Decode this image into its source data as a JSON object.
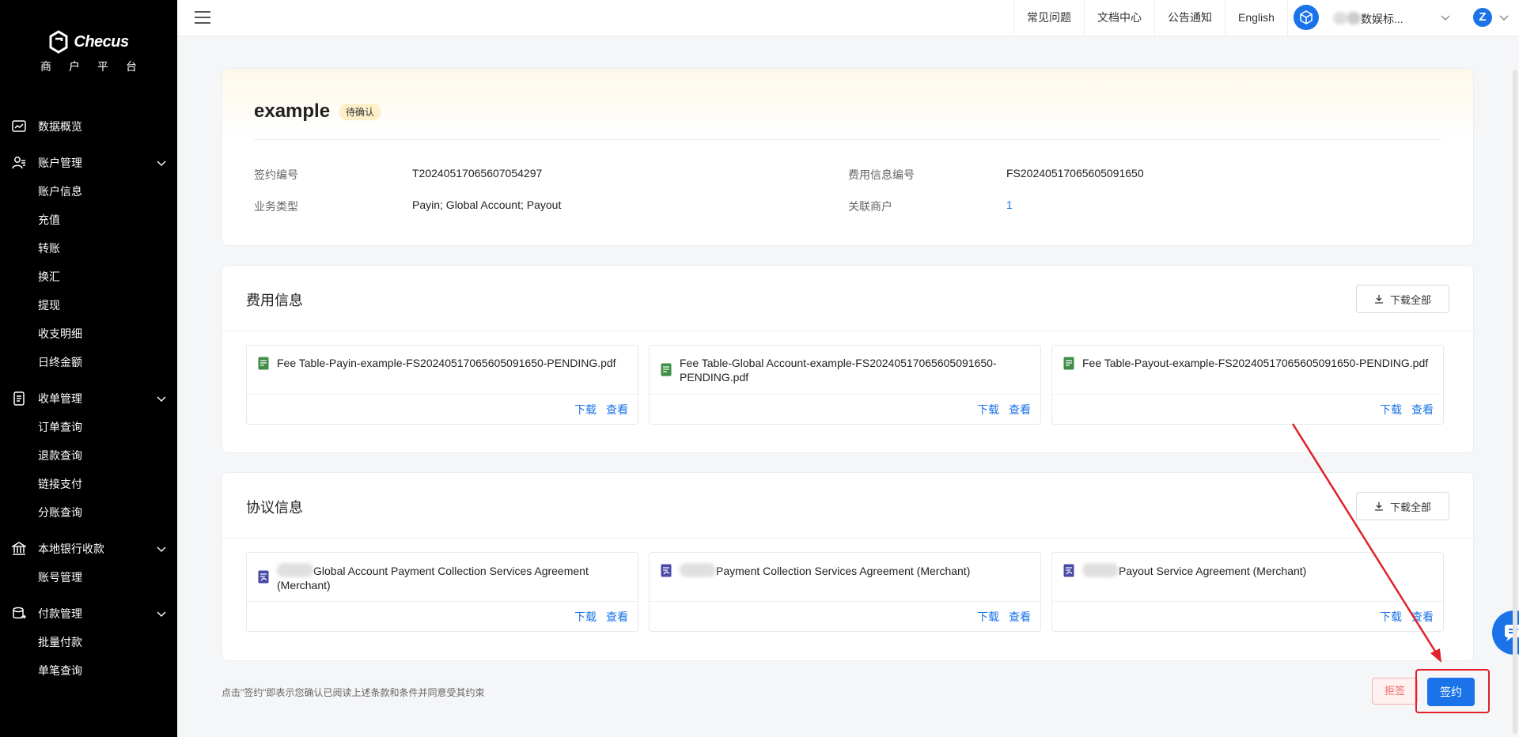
{
  "brand": {
    "name": "Checus",
    "subtitle": "商户平台"
  },
  "sidebar": {
    "groups": [
      {
        "label": "数据概览",
        "icon": "chart-icon",
        "items": []
      },
      {
        "label": "账户管理",
        "icon": "user-group-icon",
        "items": [
          "账户信息",
          "充值",
          "转账",
          "换汇",
          "提现",
          "收支明细",
          "日终金额"
        ]
      },
      {
        "label": "收单管理",
        "icon": "document-icon",
        "items": [
          "订单查询",
          "退款查询",
          "链接支付",
          "分账查询"
        ]
      },
      {
        "label": "本地银行收款",
        "icon": "bank-icon",
        "items": [
          "账号管理"
        ]
      },
      {
        "label": "付款管理",
        "icon": "payment-icon",
        "items": [
          "批量付款",
          "单笔查询"
        ]
      }
    ]
  },
  "topbar": {
    "links": [
      "常见问题",
      "文档中心",
      "公告通知",
      "English"
    ],
    "merchant_name": "数娱标...",
    "avatar_letter": "Z"
  },
  "contract": {
    "title": "example",
    "status": "待确认",
    "fields": {
      "sign_no_label": "签约编号",
      "sign_no": "T20240517065607054297",
      "fee_no_label": "费用信息编号",
      "fee_no": "FS20240517065605091650",
      "biz_type_label": "业务类型",
      "biz_type": "Payin; Global Account; Payout",
      "merchant_label": "关联商户",
      "merchant_count": "1"
    }
  },
  "fee_section": {
    "title": "费用信息",
    "download_all": "下载全部",
    "files": [
      {
        "name": "Fee Table-Payin-example-FS20240517065605091650-PENDING.pdf",
        "download": "下载",
        "view": "查看"
      },
      {
        "name": "Fee Table-Global Account-example-FS20240517065605091650-PENDING.pdf",
        "download": "下载",
        "view": "查看"
      },
      {
        "name": "Fee Table-Payout-example-FS20240517065605091650-PENDING.pdf",
        "download": "下载",
        "view": "查看"
      }
    ]
  },
  "agreement_section": {
    "title": "协议信息",
    "download_all": "下载全部",
    "files": [
      {
        "name": "Global Account Payment Collection Services Agreement (Merchant)",
        "download": "下载",
        "view": "查看"
      },
      {
        "name": "Payment Collection Services Agreement (Merchant)",
        "download": "下载",
        "view": "查看"
      },
      {
        "name": "Payout Service Agreement (Merchant)",
        "download": "下载",
        "view": "查看"
      }
    ]
  },
  "footer": {
    "hint": "点击\"签约\"即表示您确认已阅读上述条款和条件并同意受其约束",
    "reject": "拒签",
    "sign": "签约"
  },
  "colors": {
    "accent": "#1a73e8",
    "reject": "#f16565",
    "highlight": "#e0202a"
  }
}
